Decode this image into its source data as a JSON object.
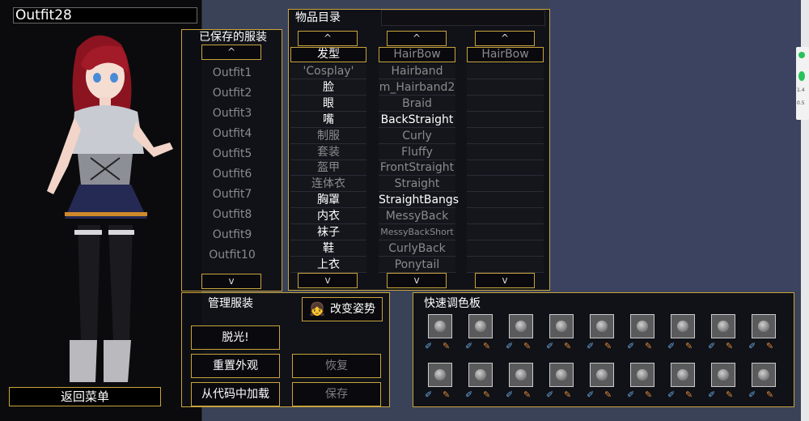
{
  "outfit_name": "Outfit28",
  "back_button": "返回菜单",
  "saved": {
    "title": "已保存的服装",
    "up": "^",
    "down": "v",
    "items": [
      "Outfit1",
      "Outfit2",
      "Outfit3",
      "Outfit4",
      "Outfit5",
      "Outfit6",
      "Outfit7",
      "Outfit8",
      "Outfit9",
      "Outfit10"
    ]
  },
  "catalog": {
    "title": "物品目录",
    "up": "^",
    "down": "v",
    "col1_header": "发型",
    "col2_header": "HairBow",
    "col3_header": "HairBow",
    "categories": [
      "'Cosplay'",
      "脸",
      "眼",
      "嘴",
      "制服",
      "套装",
      "盔甲",
      "连体衣",
      "胸罩",
      "内衣",
      "袜子",
      "鞋",
      "上衣"
    ],
    "categories_active": [
      false,
      true,
      true,
      true,
      false,
      false,
      false,
      false,
      true,
      true,
      true,
      true,
      true
    ],
    "items": [
      "Hairband",
      "m_Hairband2",
      "Braid",
      "BackStraight",
      "Curly",
      "Fluffy",
      "FrontStraight",
      "Straight",
      "StraightBangs",
      "MessyBack",
      "MessyBackShort",
      "CurlyBack",
      "Ponytail"
    ],
    "items_active": [
      false,
      false,
      false,
      true,
      false,
      false,
      false,
      false,
      true,
      false,
      false,
      false,
      false
    ]
  },
  "manage": {
    "title": "管理服装",
    "change_pose": "改变姿势",
    "strip": "脱光!",
    "reset": "重置外观",
    "restore": "恢复",
    "load_code": "从代码中加载",
    "save": "保存"
  },
  "palette": {
    "title": "快速调色板",
    "swatch_count": 18
  },
  "mini_widget": {
    "line1": "1.4",
    "line2": "0.5"
  }
}
